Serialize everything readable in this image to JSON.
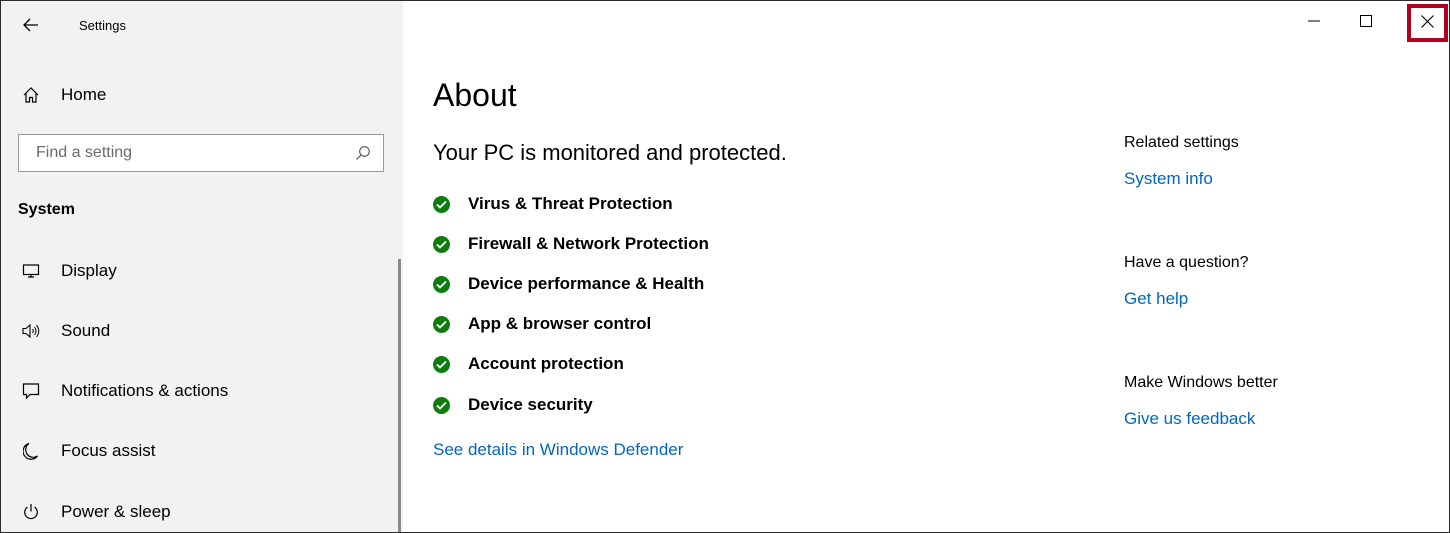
{
  "window": {
    "title": "Settings",
    "controls": {
      "minimize": "—",
      "maximize": "☐",
      "close": "✕"
    }
  },
  "sidebar": {
    "home_label": "Home",
    "search": {
      "placeholder": "Find a setting"
    },
    "section_title": "System",
    "items": [
      {
        "label": "Display",
        "icon": "display-icon"
      },
      {
        "label": "Sound",
        "icon": "speaker-icon"
      },
      {
        "label": "Notifications & actions",
        "icon": "notification-icon"
      },
      {
        "label": "Focus assist",
        "icon": "moon-icon"
      },
      {
        "label": "Power & sleep",
        "icon": "power-icon"
      }
    ]
  },
  "main": {
    "page_title": "About",
    "status_heading": "Your PC is monitored and protected.",
    "protections": [
      "Virus & Threat Protection",
      "Firewall & Network Protection",
      "Device performance & Health",
      "App & browser control",
      "Account protection",
      "Device security"
    ],
    "details_link": "See details in Windows Defender"
  },
  "related": {
    "groups": [
      {
        "heading": "Related settings",
        "link": "System info"
      },
      {
        "heading": "Have a question?",
        "link": "Get help"
      },
      {
        "heading": "Make Windows better",
        "link": "Give us feedback"
      }
    ]
  },
  "colors": {
    "accent_link": "#0067c0",
    "check_green": "#107c10",
    "sidebar_bg": "#f2f2f2",
    "close_highlight": "#b4001e"
  }
}
